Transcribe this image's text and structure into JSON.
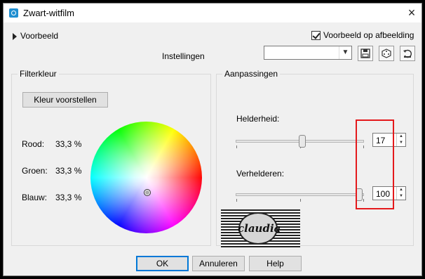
{
  "window": {
    "title": "Zwart-witfilm",
    "close_icon": "×"
  },
  "preview": {
    "label": "Voorbeeld",
    "checkbox_label": "Voorbeeld op afbeelding",
    "checked": true
  },
  "presets": {
    "label": "Instellingen",
    "value": ""
  },
  "filter_color": {
    "title": "Filterkleur",
    "suggest_button": "Kleur voorstellen",
    "red_label": "Rood:",
    "red_value": "33,3 %",
    "green_label": "Groen:",
    "green_value": "33,3 %",
    "blue_label": "Blauw:",
    "blue_value": "33,3 %"
  },
  "adjustments": {
    "title": "Aanpassingen",
    "brightness_label": "Helderheid:",
    "brightness_value": "17",
    "brighten_label": "Verhelderen:",
    "brighten_value": "100",
    "brightness_slider_fraction": 0.52,
    "brighten_slider_fraction": 1.0
  },
  "watermark": {
    "text": "claudia"
  },
  "buttons": {
    "ok": "OK",
    "cancel": "Annuleren",
    "help": "Help"
  },
  "icons": {
    "app": "camera-icon",
    "save": "save-icon",
    "random": "dice-icon",
    "reset": "reset-icon"
  },
  "colors": {
    "highlight_box": "#e4191c",
    "default_button_border": "#0078d7"
  }
}
